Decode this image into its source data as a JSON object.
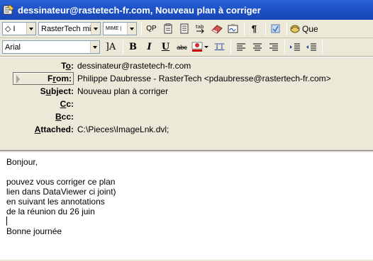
{
  "window": {
    "title": "dessinateur@rastetech-fr.com, Nouveau plan à corriger"
  },
  "toolbar1": {
    "identity_combo": "◇ I",
    "stationery_combo": "RasterTech mi",
    "mime_combo": "MIME |",
    "qp_button": "QP",
    "partial_label": "Que"
  },
  "toolbar2": {
    "font_combo": "Arial",
    "size_button": "A",
    "bold": "B",
    "italic": "I",
    "underline": "U",
    "strike": "abc",
    "tt": "TT"
  },
  "header": {
    "to_label": "To:",
    "to_value": "dessinateur@rastetech-fr.com",
    "from_label": "From:",
    "from_value": "Philippe Daubresse - RasterTech <pdaubresse@rastertech-fr.com>",
    "subject_label": "Subject:",
    "subject_value": "Nouveau plan à corriger",
    "cc_label": "Cc:",
    "cc_value": "",
    "bcc_label": "Bcc:",
    "bcc_value": "",
    "attached_label": "Attached:",
    "attached_value": "C:\\Pieces\\ImageLnk.dvl;"
  },
  "message": {
    "lines": [
      "Bonjour,",
      "",
      "pouvez vous corriger ce plan",
      "lien dans DataViewer ci joint)",
      "en suivant les annotations",
      "de la réunion du 26 juin",
      "",
      "Bonne journée"
    ]
  }
}
